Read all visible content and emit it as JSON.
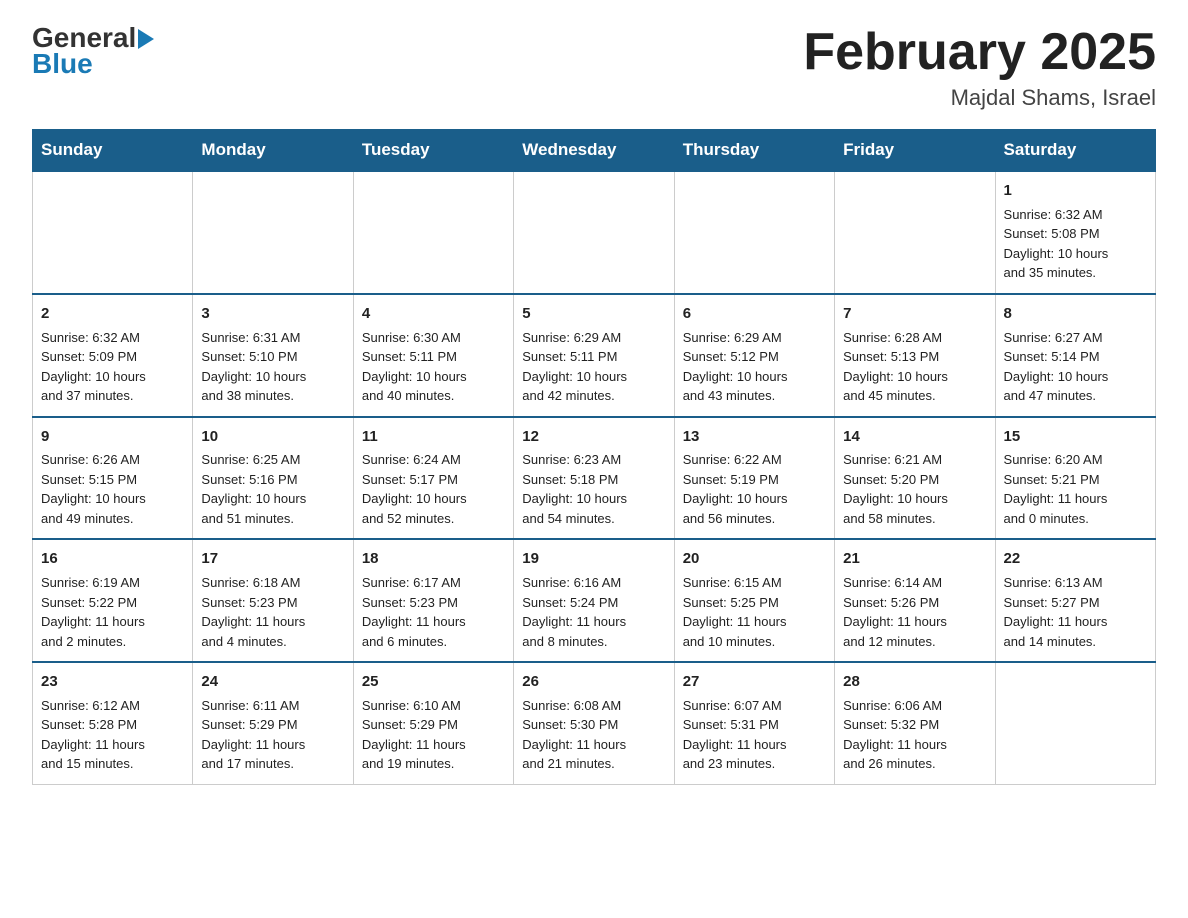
{
  "header": {
    "month_title": "February 2025",
    "location": "Majdal Shams, Israel"
  },
  "days_of_week": [
    "Sunday",
    "Monday",
    "Tuesday",
    "Wednesday",
    "Thursday",
    "Friday",
    "Saturday"
  ],
  "weeks": [
    [
      {
        "day": "",
        "info": ""
      },
      {
        "day": "",
        "info": ""
      },
      {
        "day": "",
        "info": ""
      },
      {
        "day": "",
        "info": ""
      },
      {
        "day": "",
        "info": ""
      },
      {
        "day": "",
        "info": ""
      },
      {
        "day": "1",
        "info": "Sunrise: 6:32 AM\nSunset: 5:08 PM\nDaylight: 10 hours\nand 35 minutes."
      }
    ],
    [
      {
        "day": "2",
        "info": "Sunrise: 6:32 AM\nSunset: 5:09 PM\nDaylight: 10 hours\nand 37 minutes."
      },
      {
        "day": "3",
        "info": "Sunrise: 6:31 AM\nSunset: 5:10 PM\nDaylight: 10 hours\nand 38 minutes."
      },
      {
        "day": "4",
        "info": "Sunrise: 6:30 AM\nSunset: 5:11 PM\nDaylight: 10 hours\nand 40 minutes."
      },
      {
        "day": "5",
        "info": "Sunrise: 6:29 AM\nSunset: 5:11 PM\nDaylight: 10 hours\nand 42 minutes."
      },
      {
        "day": "6",
        "info": "Sunrise: 6:29 AM\nSunset: 5:12 PM\nDaylight: 10 hours\nand 43 minutes."
      },
      {
        "day": "7",
        "info": "Sunrise: 6:28 AM\nSunset: 5:13 PM\nDaylight: 10 hours\nand 45 minutes."
      },
      {
        "day": "8",
        "info": "Sunrise: 6:27 AM\nSunset: 5:14 PM\nDaylight: 10 hours\nand 47 minutes."
      }
    ],
    [
      {
        "day": "9",
        "info": "Sunrise: 6:26 AM\nSunset: 5:15 PM\nDaylight: 10 hours\nand 49 minutes."
      },
      {
        "day": "10",
        "info": "Sunrise: 6:25 AM\nSunset: 5:16 PM\nDaylight: 10 hours\nand 51 minutes."
      },
      {
        "day": "11",
        "info": "Sunrise: 6:24 AM\nSunset: 5:17 PM\nDaylight: 10 hours\nand 52 minutes."
      },
      {
        "day": "12",
        "info": "Sunrise: 6:23 AM\nSunset: 5:18 PM\nDaylight: 10 hours\nand 54 minutes."
      },
      {
        "day": "13",
        "info": "Sunrise: 6:22 AM\nSunset: 5:19 PM\nDaylight: 10 hours\nand 56 minutes."
      },
      {
        "day": "14",
        "info": "Sunrise: 6:21 AM\nSunset: 5:20 PM\nDaylight: 10 hours\nand 58 minutes."
      },
      {
        "day": "15",
        "info": "Sunrise: 6:20 AM\nSunset: 5:21 PM\nDaylight: 11 hours\nand 0 minutes."
      }
    ],
    [
      {
        "day": "16",
        "info": "Sunrise: 6:19 AM\nSunset: 5:22 PM\nDaylight: 11 hours\nand 2 minutes."
      },
      {
        "day": "17",
        "info": "Sunrise: 6:18 AM\nSunset: 5:23 PM\nDaylight: 11 hours\nand 4 minutes."
      },
      {
        "day": "18",
        "info": "Sunrise: 6:17 AM\nSunset: 5:23 PM\nDaylight: 11 hours\nand 6 minutes."
      },
      {
        "day": "19",
        "info": "Sunrise: 6:16 AM\nSunset: 5:24 PM\nDaylight: 11 hours\nand 8 minutes."
      },
      {
        "day": "20",
        "info": "Sunrise: 6:15 AM\nSunset: 5:25 PM\nDaylight: 11 hours\nand 10 minutes."
      },
      {
        "day": "21",
        "info": "Sunrise: 6:14 AM\nSunset: 5:26 PM\nDaylight: 11 hours\nand 12 minutes."
      },
      {
        "day": "22",
        "info": "Sunrise: 6:13 AM\nSunset: 5:27 PM\nDaylight: 11 hours\nand 14 minutes."
      }
    ],
    [
      {
        "day": "23",
        "info": "Sunrise: 6:12 AM\nSunset: 5:28 PM\nDaylight: 11 hours\nand 15 minutes."
      },
      {
        "day": "24",
        "info": "Sunrise: 6:11 AM\nSunset: 5:29 PM\nDaylight: 11 hours\nand 17 minutes."
      },
      {
        "day": "25",
        "info": "Sunrise: 6:10 AM\nSunset: 5:29 PM\nDaylight: 11 hours\nand 19 minutes."
      },
      {
        "day": "26",
        "info": "Sunrise: 6:08 AM\nSunset: 5:30 PM\nDaylight: 11 hours\nand 21 minutes."
      },
      {
        "day": "27",
        "info": "Sunrise: 6:07 AM\nSunset: 5:31 PM\nDaylight: 11 hours\nand 23 minutes."
      },
      {
        "day": "28",
        "info": "Sunrise: 6:06 AM\nSunset: 5:32 PM\nDaylight: 11 hours\nand 26 minutes."
      },
      {
        "day": "",
        "info": ""
      }
    ]
  ]
}
